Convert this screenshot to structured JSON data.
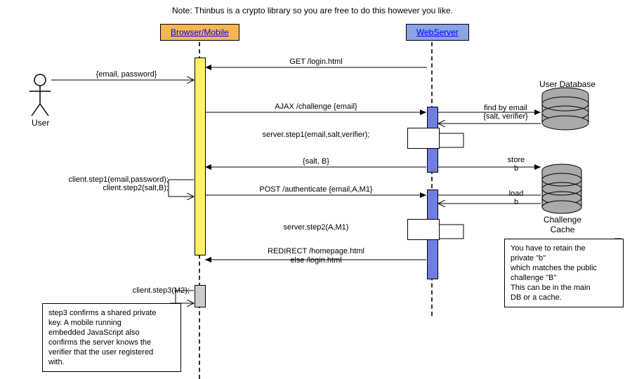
{
  "title": "Note: Thinbus is a crypto library so you are free to do this however you like.",
  "participants": {
    "browser": "Browser/Mobile",
    "server": "WebServer"
  },
  "actor_user": "User",
  "msg_user_to_browser": "{email, password}",
  "msg_get_login": "GET /login.html",
  "msg_ajax_challenge": "AJAX /challenge {email}",
  "msg_server_step1": "server.step1(email,salt,verifier);",
  "msg_salt_b": "{salt, B}",
  "msg_client_steps": "client.step1(email,password);\nclient.step2(salt,B);",
  "msg_post_auth": "POST /authenticate {email,A,M1}",
  "msg_server_step2": "server.step2(A,M1)",
  "msg_redirect": "REDIRECT /homepage.html\nelse /login.html",
  "msg_client_step3": "client.step3(M2);",
  "db_user_label": "User Database",
  "db_find": "find by email\n{salt, verifier}",
  "cache_store": "store\nb",
  "cache_load": "load\nb",
  "cache_label": "Challenge\nCache",
  "note_cache": "You have to retain the\nprivate \"b\"\nwhich matches the public\nchallenge \"B\"\nThis can be in the main\nDB or a cache.",
  "note_step3": "step3 confirms a shared private\nkey. A mobile running\nembedded JavaScript also\nconfirms the server knows the\nverifier that the user registered\nwith."
}
